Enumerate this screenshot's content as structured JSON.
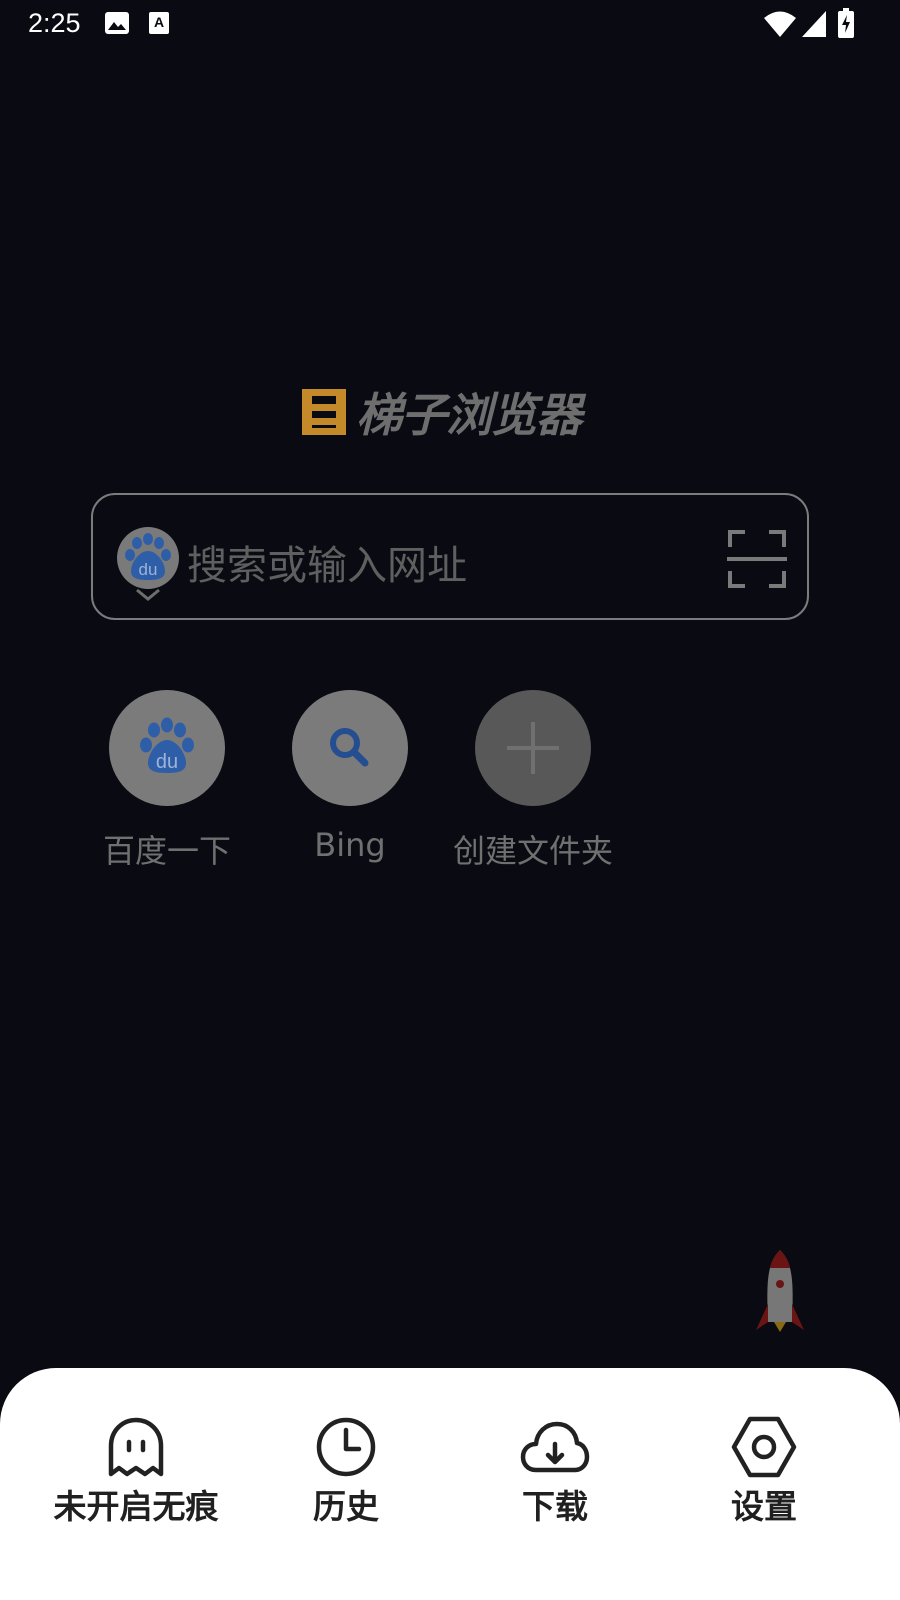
{
  "status_bar": {
    "time": "2:25",
    "icons": [
      "image-icon",
      "keyboard-a-icon",
      "wifi-icon",
      "signal-icon",
      "battery-charging-icon"
    ]
  },
  "logo": {
    "title": "梯子浏览器",
    "mark_color": "#c48a2a"
  },
  "search": {
    "engine_icon": "baidu-paw-icon",
    "placeholder": "搜索或输入网址",
    "scan_icon": "scan-icon"
  },
  "quick_links": [
    {
      "label": "百度一下",
      "icon": "baidu-paw-icon"
    },
    {
      "label": "Bing",
      "icon": "search-icon"
    },
    {
      "label": "创建文件夹",
      "icon": "plus-icon"
    }
  ],
  "floating": {
    "icon": "rocket-icon"
  },
  "bottom_menu": {
    "items": [
      {
        "label": "未开启无痕",
        "icon": "ghost-icon"
      },
      {
        "label": "历史",
        "icon": "clock-icon"
      },
      {
        "label": "下载",
        "icon": "cloud-download-icon"
      },
      {
        "label": "设置",
        "icon": "hexagon-settings-icon"
      }
    ]
  },
  "colors": {
    "background": "#090a12",
    "sheet": "#ffffff",
    "baidu_blue": "#2f6ac8"
  }
}
